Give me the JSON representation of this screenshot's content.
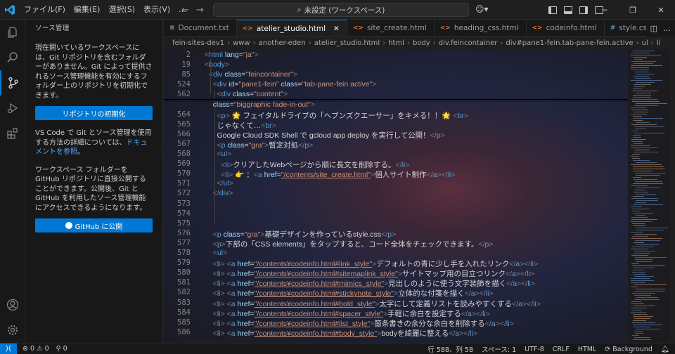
{
  "title_bar": {
    "menus": [
      "ファイル(F)",
      "編集(E)",
      "選択(S)",
      "表示(V)",
      "…"
    ],
    "command_center": "未設定 (ワークスペース)"
  },
  "sidebar": {
    "title": "ソース管理",
    "text1": "現在開いているワークスペースには、Git リポジトリを含むフォルダーがありません。Git によって提供されるソース管理機能を有効にするフォルダー上のリポジトリを初期化できます。",
    "init_button": "リポジトリの初期化",
    "text2_prefix": "VS Code で Git とソース管理を使用する方法の詳細については、",
    "text2_link": "ドキュメントを参照",
    "text2_suffix": "。",
    "text3": "ワークスペース フォルダーを GitHub リポジトリに直接公開することができます。公開後、Git と GitHub を利用したソース管理機能にアクセスできるようになります。",
    "publish_button": "GitHub に公開"
  },
  "tabs": [
    {
      "label": "Document.txt",
      "icon": "≡",
      "color": "#9d9d9d"
    },
    {
      "label": "atelier_studio.html",
      "icon": "<>",
      "color": "#e37933",
      "active": true
    },
    {
      "label": "site_create.html",
      "icon": "<>",
      "color": "#e37933"
    },
    {
      "label": "heading_css.html",
      "icon": "<>",
      "color": "#e37933"
    },
    {
      "label": "codeinfo.html",
      "icon": "<>",
      "color": "#e37933"
    },
    {
      "label": "style.css",
      "icon": "#",
      "color": "#519aba"
    }
  ],
  "breadcrumbs": [
    "fein-sites-dev1",
    "www",
    "another-eden",
    "atelier_studio.html",
    "html",
    "body",
    "div.feincontainer",
    "div#pane1-fein.tab-pane-fein.active",
    "ul",
    "li"
  ],
  "editor": {
    "lines": [
      {
        "n": "2",
        "h": "<span class='p'>&lt;</span><span class='t'>html</span> <span class='a'>lang</span><span class='x'>=</span><span class='v'>\"ja\"</span><span class='p'>&gt;</span>"
      },
      {
        "n": "19",
        "h": "<span class='p'>&lt;</span><span class='t'>body</span><span class='p'>&gt;</span>"
      },
      {
        "n": "85",
        "h": "  <span class='p'>&lt;</span><span class='t'>div</span> <span class='a'>class</span><span class='x'>=</span><span class='v'>\"feincontainer\"</span><span class='p'>&gt;</span>"
      },
      {
        "n": "524",
        "h": "    <span class='p'>&lt;</span><span class='t'>div</span> <span class='a'>id</span><span class='x'>=</span><span class='v'>\"pane1-fein\"</span> <span class='a'>class</span><span class='x'>=</span><span class='v'>\"tab-pane-fein active\"</span><span class='p'>&gt;</span>"
      },
      {
        "n": "562",
        "h": "      <span class='p'>&lt;</span><span class='t'>div</span> <span class='a'>class</span><span class='x'>=</span><span class='v'>\"content\"</span><span class='p'>&gt;</span>"
      },
      {
        "n": "",
        "h": "    <span class='a'>class</span><span class='x'>=</span><span class='v'>\"biggraphic fade-in-out\"</span><span class='p'>&gt;</span>"
      },
      {
        "n": "564",
        "h": "      <span class='p'>&lt;</span><span class='t'>p</span><span class='p'>&gt;</span><span class='x'> 🌟 フェイタルドライブの「ヘブンズクエーサー」をキメる！！🌟 </span><span class='p'>&lt;</span><span class='t'>br</span><span class='p'>&gt;</span>"
      },
      {
        "n": "565",
        "h": "      <span class='x'>じゃなくて…</span><span class='p'>&lt;</span><span class='t'>br</span><span class='p'>&gt;</span>"
      },
      {
        "n": "566",
        "h": "      <span class='x'>Google Cloud SDK Shell で gcloud app deploy を実行して公開！</span><span class='p'>&lt;/</span><span class='t'>p</span><span class='p'>&gt;</span>"
      },
      {
        "n": "567",
        "h": "      <span class='p'>&lt;</span><span class='t'>p</span> <span class='a'>class</span><span class='x'>=</span><span class='v'>\"gra\"</span><span class='p'>&gt;</span><span class='x'>暫定対処</span><span class='p'>&lt;/</span><span class='t'>p</span><span class='p'>&gt;</span>"
      },
      {
        "n": "568",
        "h": "      <span class='p'>&lt;</span><span class='t'>ul</span><span class='p'>&gt;</span>"
      },
      {
        "n": "569",
        "h": "        <span class='p'>&lt;</span><span class='t'>li</span><span class='p'>&gt;</span><span class='x'>クリアしたWebページから順に長文を削除する。</span><span class='p'>&lt;/</span><span class='t'>li</span><span class='p'>&gt;</span>"
      },
      {
        "n": "570",
        "h": "        <span class='p'>&lt;</span><span class='t'>li</span><span class='p'>&gt;</span><span class='x'> 👉 ：</span><span class='p'>&lt;</span><span class='t'>a</span> <span class='a'>href</span><span class='x'>=</span><span class='v u'>\"/contents/site_create.html\"</span><span class='p'>&gt;</span><span class='x'>個人サイト制作</span><span class='p'>&lt;/</span><span class='t'>a</span><span class='p'>&gt;&lt;/</span><span class='t'>li</span><span class='p'>&gt;</span>"
      },
      {
        "n": "571",
        "h": "      <span class='p'>&lt;/</span><span class='t'>ul</span><span class='p'>&gt;</span>"
      },
      {
        "n": "572",
        "h": "    <span class='p'>&lt;/</span><span class='t'>div</span><span class='p'>&gt;</span>"
      },
      {
        "n": "573",
        "h": ""
      },
      {
        "n": "574",
        "h": ""
      },
      {
        "n": "575",
        "h": ""
      },
      {
        "n": "576",
        "h": "    <span class='p'>&lt;</span><span class='t'>p</span> <span class='a'>class</span><span class='x'>=</span><span class='v'>\"gra\"</span><span class='p'>&gt;</span><span class='x'>基礎デザインを作っているstyle.css</span><span class='p'>&lt;/</span><span class='t'>p</span><span class='p'>&gt;</span>"
      },
      {
        "n": "577",
        "h": "    <span class='p'>&lt;</span><span class='t'>p</span><span class='p'>&gt;</span><span class='x'>下部の「CSS elements」をタップすると、コード全体をチェックできます。</span><span class='p'>&lt;/</span><span class='t'>p</span><span class='p'>&gt;</span>"
      },
      {
        "n": "578",
        "h": "    <span class='p'>&lt;</span><span class='t'>ul</span><span class='p'>&gt;</span>"
      },
      {
        "n": "579",
        "h": "    <span class='p'>&lt;</span><span class='t'>li</span><span class='p'>&gt;</span> <span class='p'>&lt;</span><span class='t'>a</span> <span class='a'>href</span><span class='x'>=</span><span class='v u'>\"/contents¥codeinfo.html#link_style\"</span><span class='p'>&gt;</span><span class='x'>デフォルトの青に少し手を入れたリンク</span><span class='p'>&lt;/</span><span class='t'>a</span><span class='p'>&gt;&lt;/</span><span class='t'>li</span><span class='p'>&gt;</span>"
      },
      {
        "n": "580",
        "h": "    <span class='p'>&lt;</span><span class='t'>li</span><span class='p'>&gt;</span> <span class='p'>&lt;</span><span class='t'>a</span> <span class='a'>href</span><span class='x'>=</span><span class='v u'>\"/contents¥codeinfo.html#sitemaplink_style\"</span><span class='p'>&gt;</span><span class='x'>サイトマップ用の目立つリンク</span><span class='p'>&lt;/</span><span class='t'>a</span><span class='p'>&gt;&lt;/</span><span class='t'>li</span><span class='p'>&gt;</span>"
      },
      {
        "n": "581",
        "h": "    <span class='p'>&lt;</span><span class='t'>li</span><span class='p'>&gt;</span> <span class='p'>&lt;</span><span class='t'>a</span> <span class='a'>href</span><span class='x'>=</span><span class='v u'>\"/contents¥codeinfo.html#mimics_style\"</span><span class='p'>&gt;</span><span class='x'>見出しのように使う文字装飾を描く</span><span class='p'>&lt;/</span><span class='t'>a</span><span class='p'>&gt;&lt;/</span><span class='t'>li</span><span class='p'>&gt;</span>"
      },
      {
        "n": "582",
        "h": "    <span class='p'>&lt;</span><span class='t'>li</span><span class='p'>&gt;</span> <span class='p'>&lt;</span><span class='t'>a</span> <span class='a'>href</span><span class='x'>=</span><span class='v u'>\"/contents¥codeinfo.html#stickynote_style\"</span><span class='p'>&gt;</span><span class='x'>立体的な付箋を描く</span><span class='p'>&lt;/</span><span class='t'>a</span><span class='p'>&gt;&lt;/</span><span class='t'>li</span><span class='p'>&gt;</span>"
      },
      {
        "n": "583",
        "h": "    <span class='p'>&lt;</span><span class='t'>li</span><span class='p'>&gt;</span> <span class='p'>&lt;</span><span class='t'>a</span> <span class='a'>href</span><span class='x'>=</span><span class='v u'>\"/contents¥codeinfo.html#bold_style\"</span><span class='p'>&gt;</span><span class='x'>太字にして定義リストを読みやすくする</span><span class='p'>&lt;/</span><span class='t'>a</span><span class='p'>&gt;&lt;/</span><span class='t'>li</span><span class='p'>&gt;</span>"
      },
      {
        "n": "584",
        "h": "    <span class='p'>&lt;</span><span class='t'>li</span><span class='p'>&gt;</span> <span class='p'>&lt;</span><span class='t'>a</span> <span class='a'>href</span><span class='x'>=</span><span class='v u'>\"/contents¥codeinfo.html#spacer_style\"</span><span class='p'>&gt;</span><span class='x'>手軽に余白を設定する</span><span class='p'>&lt;/</span><span class='t'>a</span><span class='p'>&gt;&lt;/</span><span class='t'>li</span><span class='p'>&gt;</span>"
      },
      {
        "n": "585",
        "h": "    <span class='p'>&lt;</span><span class='t'>li</span><span class='p'>&gt;</span> <span class='p'>&lt;</span><span class='t'>a</span> <span class='a'>href</span><span class='x'>=</span><span class='v u'>\"/contents¥codeinfo.html#list_style\"</span><span class='p'>&gt;</span><span class='x'>箇条書きの余分な余白を削除する</span><span class='p'>&lt;/</span><span class='t'>a</span><span class='p'>&gt;&lt;/</span><span class='t'>li</span><span class='p'>&gt;</span>"
      },
      {
        "n": "586",
        "h": "    <span class='p'>&lt;</span><span class='t'>li</span><span class='p'>&gt;</span> <span class='p'>&lt;</span><span class='t'>a</span> <span class='a'>href</span><span class='x'>=</span><span class='v u'>\"/contents¥codeinfo.html#body_style\"</span><span class='p'>&gt;</span><span class='x'>bodyを綺麗に整える</span><span class='p'>&lt;/</span><span class='t'>a</span><span class='p'>&gt;&lt;/</span><span class='t'>li</span><span class='p'>&gt;</span>"
      }
    ]
  },
  "status_bar": {
    "errors": "0",
    "warnings": "0",
    "ports": "0",
    "position": "行 588、列 58",
    "spaces": "スペース: 1",
    "encoding": "UTF-8",
    "eol": "CRLF",
    "language": "HTML",
    "extra": "Background"
  }
}
